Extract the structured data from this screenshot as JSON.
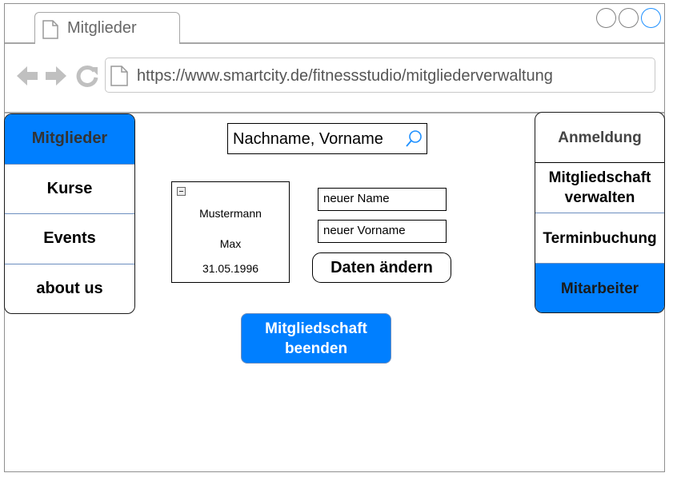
{
  "browser": {
    "tab_title": "Mitglieder",
    "url": "https://www.smartcity.de/fitnessstudio/mitgliederverwaltung",
    "icons": [
      "back-arrow-icon",
      "forward-arrow-icon",
      "reload-icon",
      "page-icon"
    ]
  },
  "sidebar": {
    "items": [
      {
        "label": "Mitglieder",
        "active": true
      },
      {
        "label": "Kurse"
      },
      {
        "label": "Events"
      },
      {
        "label": "about us"
      }
    ]
  },
  "search": {
    "text": "Nachname, Vorname"
  },
  "member": {
    "last_name": "Mustermann",
    "first_name": "Max",
    "birthdate": "31.05.1996"
  },
  "edit": {
    "name_field": "neuer Name",
    "firstname_field": "neuer Vorname",
    "submit_label": "Daten ändern"
  },
  "end_membership": {
    "line1": "Mitgliedschaft",
    "line2": "beenden"
  },
  "right_menu": {
    "login": "Anmeldung",
    "manage_line1": "Mitgliedschaft",
    "manage_line2": "verwalten",
    "booking": "Terminbuchung",
    "staff": "Mitarbeiter"
  },
  "colors": {
    "accent": "#007fff",
    "border_blue": "#6c8ebf"
  }
}
